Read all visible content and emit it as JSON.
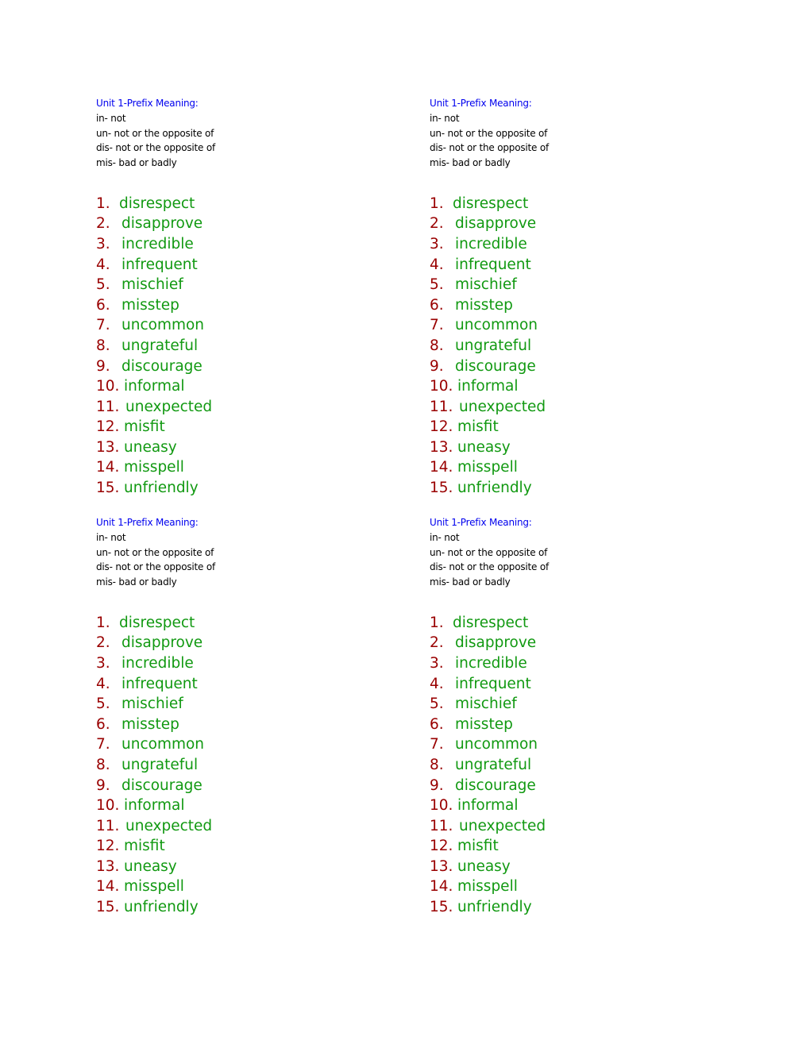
{
  "colors": {
    "heading": "#0000ee",
    "definition": "#000000",
    "number": "#990000",
    "word": "#119911"
  },
  "blocks": [
    {
      "heading": "Unit 1-Prefix Meaning:",
      "definitions": [
        "in- not",
        "un- not or the opposite of",
        "dis- not or the opposite of",
        "mis- bad or badly"
      ],
      "words": [
        {
          "num": "1.",
          "word": "disrespect"
        },
        {
          "num": "2.",
          "word": "disapprove"
        },
        {
          "num": "3.",
          "word": "incredible"
        },
        {
          "num": "4.",
          "word": "infrequent"
        },
        {
          "num": "5.",
          "word": "mischief"
        },
        {
          "num": "6.",
          "word": "misstep"
        },
        {
          "num": "7.",
          "word": "uncommon"
        },
        {
          "num": "8.",
          "word": "ungrateful"
        },
        {
          "num": "9.",
          "word": "discourage"
        },
        {
          "num": "10.",
          "word": "informal"
        },
        {
          "num": "11.",
          "word": "unexpected"
        },
        {
          "num": "12.",
          "word": "misfit"
        },
        {
          "num": "13.",
          "word": "uneasy"
        },
        {
          "num": "14.",
          "word": "misspell"
        },
        {
          "num": "15.",
          "word": "unfriendly"
        }
      ]
    },
    {
      "heading": "Unit 1-Prefix Meaning:",
      "definitions": [
        "in- not",
        "un- not or the opposite of",
        "dis- not or the opposite of",
        "mis- bad or badly"
      ],
      "words": [
        {
          "num": "1.",
          "word": "disrespect"
        },
        {
          "num": "2.",
          "word": "disapprove"
        },
        {
          "num": "3.",
          "word": "incredible"
        },
        {
          "num": "4.",
          "word": "infrequent"
        },
        {
          "num": "5.",
          "word": "mischief"
        },
        {
          "num": "6.",
          "word": "misstep"
        },
        {
          "num": "7.",
          "word": "uncommon"
        },
        {
          "num": "8.",
          "word": "ungrateful"
        },
        {
          "num": "9.",
          "word": "discourage"
        },
        {
          "num": "10.",
          "word": "informal"
        },
        {
          "num": "11.",
          "word": "unexpected"
        },
        {
          "num": "12.",
          "word": "misfit"
        },
        {
          "num": "13.",
          "word": "uneasy"
        },
        {
          "num": "14.",
          "word": "misspell"
        },
        {
          "num": "15.",
          "word": "unfriendly"
        }
      ]
    },
    {
      "heading": "Unit 1-Prefix Meaning:",
      "definitions": [
        "in- not",
        "un- not or the opposite of",
        "dis- not or the opposite of",
        "mis- bad or badly"
      ],
      "words": [
        {
          "num": "1.",
          "word": "disrespect"
        },
        {
          "num": "2.",
          "word": "disapprove"
        },
        {
          "num": "3.",
          "word": "incredible"
        },
        {
          "num": "4.",
          "word": "infrequent"
        },
        {
          "num": "5.",
          "word": "mischief"
        },
        {
          "num": "6.",
          "word": "misstep"
        },
        {
          "num": "7.",
          "word": "uncommon"
        },
        {
          "num": "8.",
          "word": "ungrateful"
        },
        {
          "num": "9.",
          "word": "discourage"
        },
        {
          "num": "10.",
          "word": "informal"
        },
        {
          "num": "11.",
          "word": "unexpected"
        },
        {
          "num": "12.",
          "word": "misfit"
        },
        {
          "num": "13.",
          "word": "uneasy"
        },
        {
          "num": "14.",
          "word": "misspell"
        },
        {
          "num": "15.",
          "word": "unfriendly"
        }
      ]
    },
    {
      "heading": "Unit 1-Prefix Meaning:",
      "definitions": [
        "in- not",
        "un- not or the opposite of",
        "dis- not or the opposite of",
        "mis- bad or badly"
      ],
      "words": [
        {
          "num": "1.",
          "word": "disrespect"
        },
        {
          "num": "2.",
          "word": "disapprove"
        },
        {
          "num": "3.",
          "word": "incredible"
        },
        {
          "num": "4.",
          "word": "infrequent"
        },
        {
          "num": "5.",
          "word": "mischief"
        },
        {
          "num": "6.",
          "word": "misstep"
        },
        {
          "num": "7.",
          "word": "uncommon"
        },
        {
          "num": "8.",
          "word": "ungrateful"
        },
        {
          "num": "9.",
          "word": "discourage"
        },
        {
          "num": "10.",
          "word": "informal"
        },
        {
          "num": "11.",
          "word": "unexpected"
        },
        {
          "num": "12.",
          "word": "misfit"
        },
        {
          "num": "13.",
          "word": "uneasy"
        },
        {
          "num": "14.",
          "word": "misspell"
        },
        {
          "num": "15.",
          "word": "unfriendly"
        }
      ]
    }
  ]
}
